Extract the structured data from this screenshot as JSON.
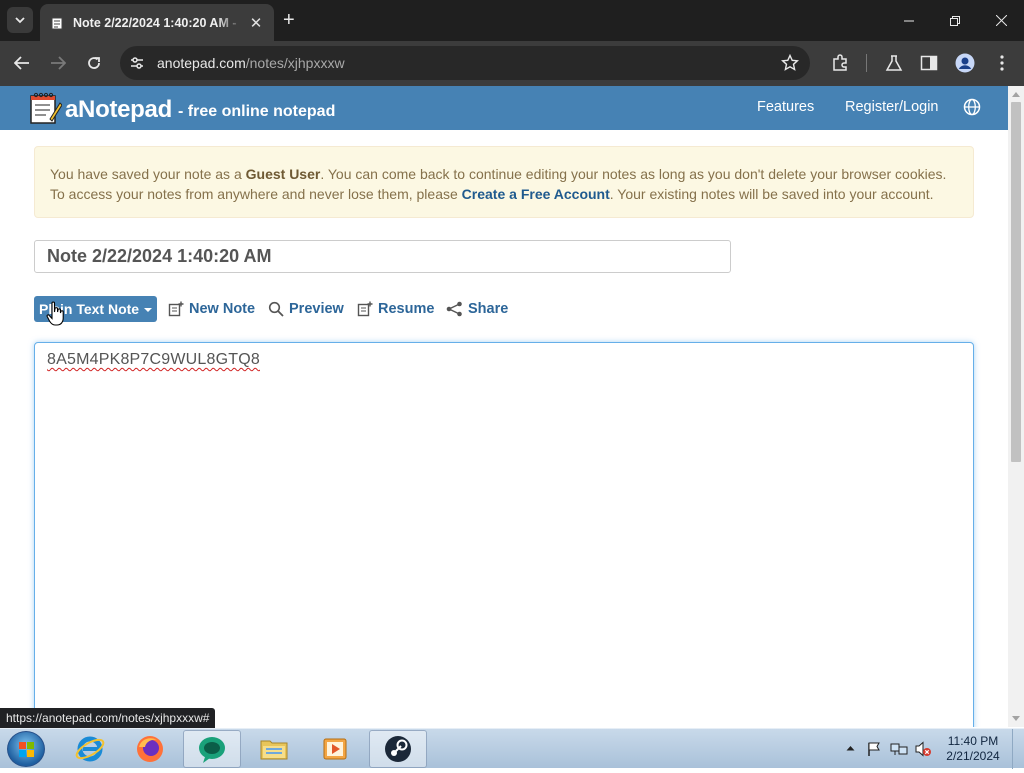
{
  "browser": {
    "tab_title": "Note 2/22/2024 1:40:20 AM - ",
    "url_domain": "anotepad.com",
    "url_path": "/notes/xjhpxxxw",
    "status_url": "https://anotepad.com/notes/xjhpxxxw#"
  },
  "site": {
    "logo": "aNotepad",
    "tagline": "- free online notepad",
    "nav": [
      "Features",
      "Register/Login"
    ],
    "brand_color": "#4682b4"
  },
  "alert": {
    "part1": "You have saved your note as a ",
    "guest": "Guest User",
    "part2": ". You can come back to continue editing your notes as long as you don't delete your browser cookies. To access your notes from anywhere and never lose them, please ",
    "cta": "Create a Free Account",
    "part3": ". Your existing notes will be saved into your account."
  },
  "note": {
    "title": "Note 2/22/2024 1:40:20 AM",
    "type_label": "Plain Text Note",
    "content": "8A5M4PK8P7C9WUL8GTQ8"
  },
  "actions": [
    "New Note",
    "Preview",
    "Resume",
    "Share"
  ],
  "taskbar": {
    "time": "11:40 PM",
    "date": "2/21/2024"
  }
}
